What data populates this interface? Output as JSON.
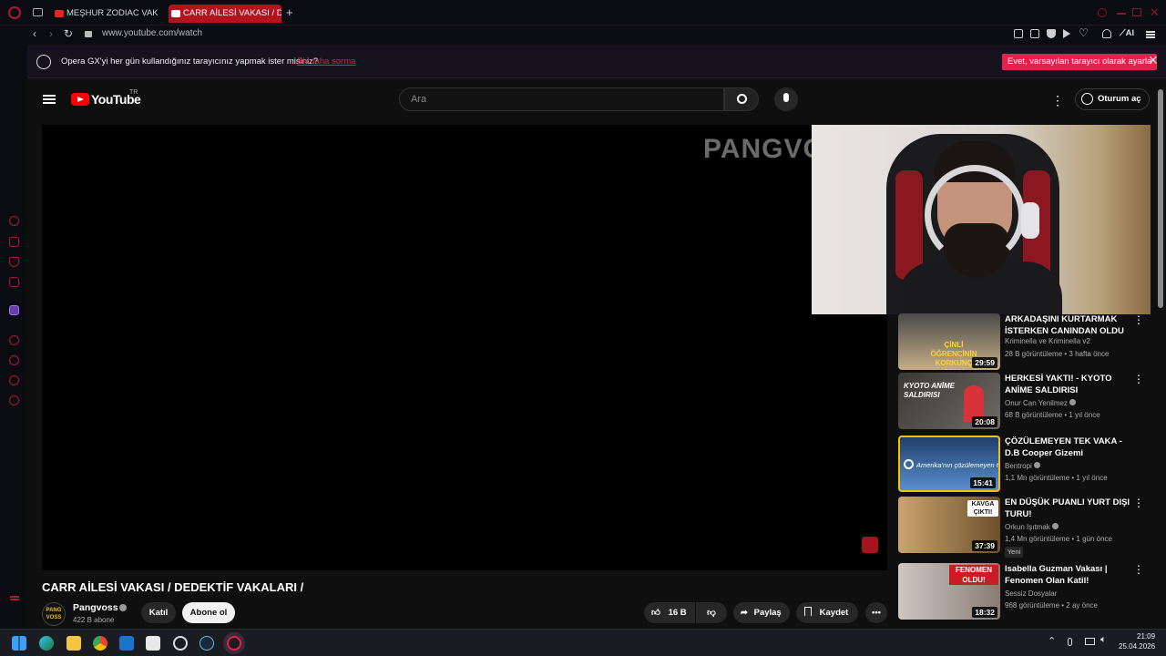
{
  "browser": {
    "tabs": [
      {
        "label": "MEŞHUR ZODIAC VAKASI"
      },
      {
        "label": "CARR AİLESİ VAKASI / DEDEKTİF"
      }
    ],
    "url": "www.youtube.com/watch",
    "ai_label": "AI",
    "accent": "#e0224d"
  },
  "opera_prompt": {
    "text": "Opera GX'yi her gün kullandığınız tarayıcınız yapmak ister misiniz?",
    "link": "Bir daha sorma",
    "button": "Evet, varsayılan tarayıcı olarak ayarla"
  },
  "youtube": {
    "logo_text": "YouTube",
    "country": "TR",
    "search_placeholder": "Ara",
    "signin": "Oturum aç"
  },
  "player": {
    "watermark": "PANGVO"
  },
  "video": {
    "title": "CARR AİLESİ VAKASI / DEDEKTİF VAKALARI /",
    "channel": "Pangvoss",
    "avatar_text": "PANG VOSS",
    "subscribers": "422 B abone",
    "join": "Katıl",
    "subscribe": "Abone ol",
    "likes": "16 B",
    "share": "Paylaş",
    "save": "Kaydet"
  },
  "recommendations": [
    {
      "title": "ARKADAŞINI KURTARMAK İSTERKEN CANINDAN OLDU",
      "channel": "Kriminella ve Kriminella v2",
      "meta": "28 B görüntüleme • 3 hafta önce",
      "duration": "29:59",
      "thumb_text": "ÇİNLİ ÖĞRENCİNİN KORKUNÇ SONU",
      "thumb_color": "#b9a07a"
    },
    {
      "title": "HERKESİ YAKTI! - KYOTO ANİME SALDIRISI",
      "channel": "Onur Can Yenilmez",
      "meta": "68 B görüntüleme • 1 yıl önce",
      "duration": "20:08",
      "thumb_text": "KYOTO ANİME SALDIRISI",
      "thumb_color": "#56504a"
    },
    {
      "title": "ÇÖZÜLEMEYEN TEK VAKA - D.B Cooper Gizemi",
      "channel": "Bentropi",
      "meta": "1,1 Mn görüntüleme • 1 yıl önce",
      "duration": "15:41",
      "thumb_text": "Amerika'nın çözülemeyen tek davası",
      "thumb_color": "#3e6fa8"
    },
    {
      "title": "EN DÜŞÜK PUANLI YURT DIŞI TURU!",
      "channel": "Orkun Işıtmak",
      "meta": "1,4 Mn görüntüleme • 1 gün önce",
      "duration": "37:39",
      "thumb_text": "KAVGA ÇIKTI!",
      "thumb_color": "#8a6a3e",
      "badge": "Yeni"
    },
    {
      "title": "Isabella Guzman Vakası | Fenomen Olan Katil!",
      "channel": "Sessiz Dosyalar",
      "meta": "968 görüntüleme • 2 ay önce",
      "duration": "18:32",
      "thumb_text": "FENOMEN OLDU!",
      "thumb_color": "#9c8c84"
    }
  ],
  "taskbar": {
    "time": "21:09",
    "date": "25.04.2026"
  }
}
